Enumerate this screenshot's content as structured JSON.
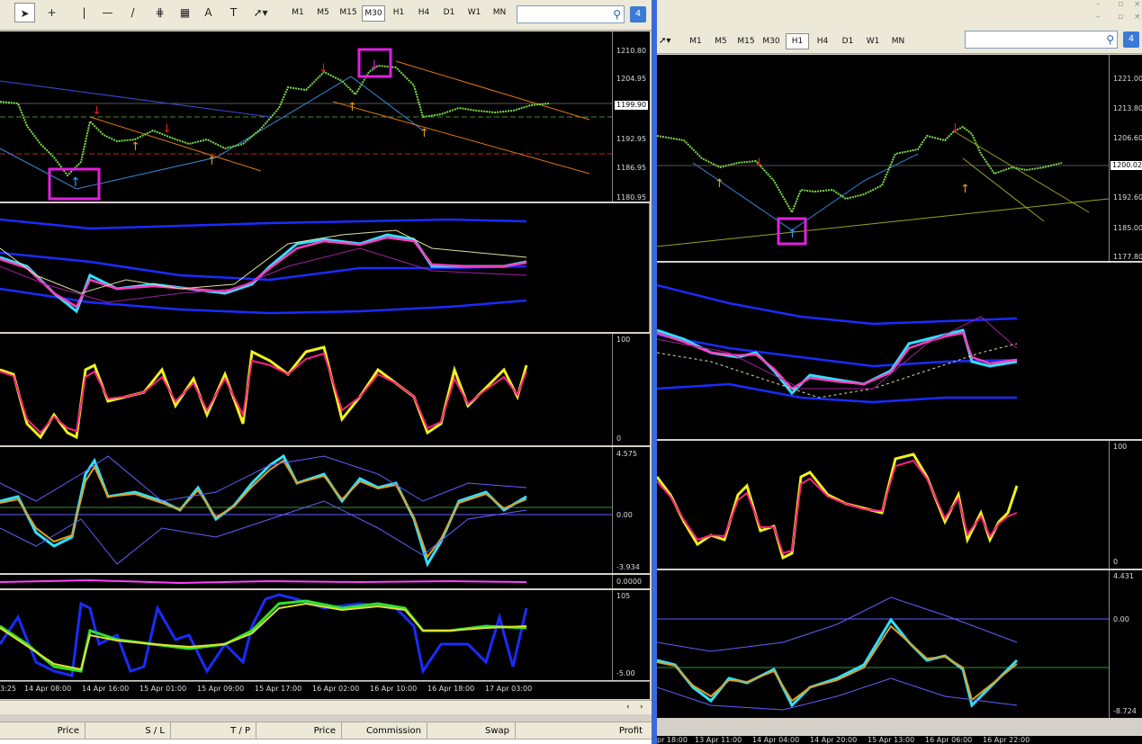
{
  "left_window": {
    "timeframes": [
      "M1",
      "M5",
      "M15",
      "M30",
      "H1",
      "H4",
      "D1",
      "W1",
      "MN"
    ],
    "active_timeframe": "M30",
    "price_scale": [
      "1210.80",
      "1204.95",
      "1199.90",
      "1192.95",
      "1186.95",
      "1180.95"
    ],
    "current_price": "1199.90",
    "stoch_scale": [
      "100",
      "0"
    ],
    "macd_scale": [
      "4.575",
      "0.00",
      "-3.934"
    ],
    "small_scale": "0.0000",
    "bottom_scale": [
      "105",
      "-5.00"
    ],
    "time_axis": [
      "3:25",
      "14 Apr 08:00",
      "14 Apr 16:00",
      "15 Apr 01:00",
      "15 Apr 09:00",
      "15 Apr 17:00",
      "16 Apr 02:00",
      "16 Apr 10:00",
      "16 Apr 18:00",
      "17 Apr 03:00"
    ]
  },
  "right_window": {
    "timeframes": [
      "M1",
      "M5",
      "M15",
      "M30",
      "H1",
      "H4",
      "D1",
      "W1",
      "MN"
    ],
    "active_timeframe": "H1",
    "price_scale": [
      "1221.00",
      "1213.80",
      "1206.60",
      "1200.02",
      "1192.60",
      "1185.00",
      "1177.80"
    ],
    "current_price": "1200.02",
    "stoch_scale": [
      "100",
      "0"
    ],
    "macd_scale": [
      "4.431",
      "0.00",
      "-8.724"
    ],
    "time_axis": [
      "pr 18:00",
      "13 Apr 11:00",
      "14 Apr 04:00",
      "14 Apr 20:00",
      "15 Apr 13:00",
      "16 Apr 06:00",
      "16 Apr 22:00"
    ]
  },
  "terminal": {
    "columns": [
      "Price",
      "S / L",
      "T / P",
      "Price",
      "Commission",
      "Swap",
      "Profit"
    ]
  },
  "colors": {
    "bg": "#000000",
    "candle": "#7ddc4a",
    "up_arrow": "#e0a020",
    "down_arrow": "#e02020",
    "highlight": "#e020e0",
    "cyan": "#30e0ff",
    "yellow": "#f0f020",
    "magenta": "#ff40c0",
    "blue": "#1a2cff"
  }
}
